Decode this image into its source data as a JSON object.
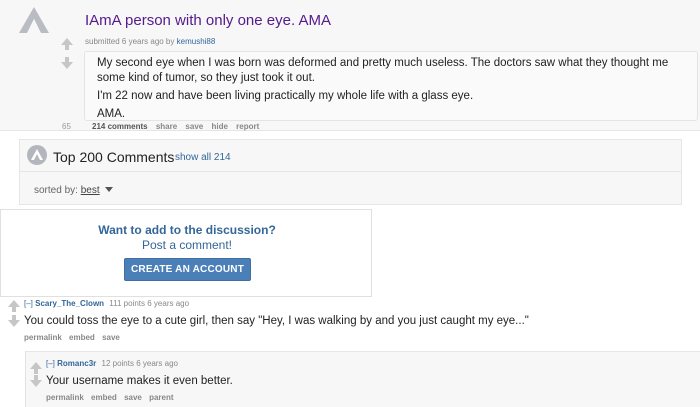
{
  "post": {
    "title": "IAmA person with only one eye. AMA",
    "submitted_prefix": "submitted 6 years ago by",
    "author": "kemushi88",
    "score": "65",
    "body": [
      "My second eye when I was born was deformed and pretty much useless. The doctors saw what they thought me",
      "some kind of tumor, so they just took it out.",
      "I'm 22 now and have been living practically my whole life with a glass eye.",
      "AMA."
    ],
    "links": {
      "comments": "214 comments",
      "share": "share",
      "save": "save",
      "hide": "hide",
      "report": "report"
    }
  },
  "comments_header": {
    "title": "Top 200 Comments",
    "show_all": "show all 214",
    "sorted_label": "sorted by:",
    "sorted_value": "best"
  },
  "discussion": {
    "prompt": "Want to add to the discussion?",
    "subprompt": "Post a comment!",
    "button": "CREATE AN ACCOUNT"
  },
  "comment": {
    "expand": "[–]",
    "author": "Scary_The_Clown",
    "meta": "111 points 6 years ago",
    "body": "You could toss the eye to a cute girl, then say \"Hey, I was walking by and you just caught my eye...\"",
    "links": {
      "permalink": "permalink",
      "embed": "embed",
      "save": "save"
    }
  },
  "reply": {
    "expand": "[–]",
    "author": "Romanc3r",
    "meta": "12 points 6 years ago",
    "body": "Your username makes it even better.",
    "links": {
      "permalink": "permalink",
      "embed": "embed",
      "save": "save",
      "parent": "parent"
    }
  },
  "icons": {
    "logo": "reddit-alien-logo",
    "upvote": "up-arrow-icon",
    "downvote": "down-arrow-icon",
    "caret": "caret-down-icon"
  },
  "colors": {
    "title": "#551a8b",
    "link": "#336699",
    "button": "#4a7fb8"
  }
}
